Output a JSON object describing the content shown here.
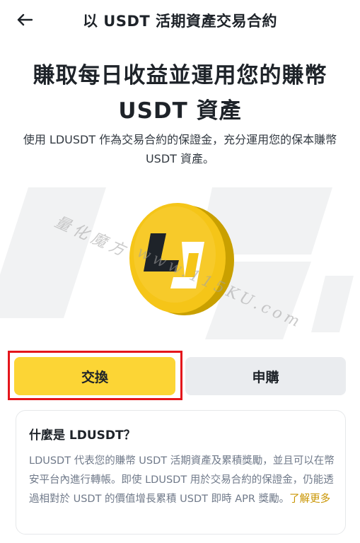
{
  "header": {
    "title": "以 USDT 活期資產交易合約"
  },
  "hero": {
    "title": "賺取每日收益並運用您的賺幣 USDT 資產",
    "subtitle": "使用 LDUSDT 作為交易合約的保證金，充分運用您的保本賺幣 USDT 資產。"
  },
  "watermark": {
    "line1": "量化魔方",
    "line2": "www.115KU.com"
  },
  "actions": {
    "swap_label": "交換",
    "subscribe_label": "申購"
  },
  "info": {
    "title": "什麼是 LDUSDT？",
    "body": "LDUSDT 代表您的賺幣 USDT 活期資產及累積獎勵，並且可以在幣安平台內進行轉帳。即使 LDUSDT 用於交易合約的保證金，仍能透過相對於 USDT 的價值增長累積 USDT 即時 APR 獎勵。",
    "link_label": "了解更多"
  },
  "colors": {
    "accent": "#fcd535",
    "highlight_border": "#e4151b",
    "link": "#c99400"
  }
}
